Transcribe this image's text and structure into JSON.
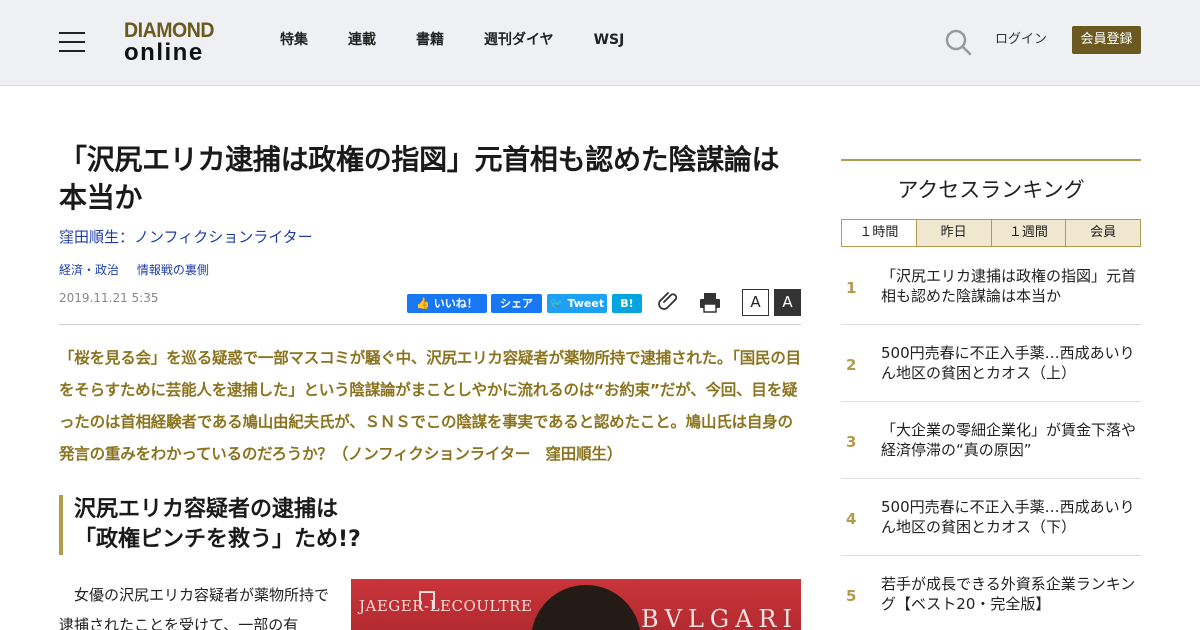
{
  "header": {
    "logo_line1": "DIAMOND",
    "logo_line2": "online",
    "nav": [
      "特集",
      "連載",
      "書籍",
      "週刊ダイヤ",
      "WSJ"
    ],
    "login_label": "ログイン",
    "register_label": "会員登録"
  },
  "article": {
    "title": "「沢尻エリカ逮捕は政権の指図」元首相も認めた陰謀論は本当か",
    "author": "窪田順生：ノンフィクションライター",
    "categories": [
      "経済・政治",
      "情報戦の裏側"
    ],
    "date": "2019.11.21 5:35",
    "share": {
      "like_label": "いいね！",
      "share_label": "シェア",
      "tweet_label": "Tweet",
      "hatena_label": "B!"
    },
    "font_small": "A",
    "font_large": "A",
    "lead": "「桜を見る会」を巡る疑惑で一部マスコミが騒ぐ中、沢尻エリカ容疑者が薬物所持で逮捕された。「国民の目をそらすために芸能人を逮捕した」という陰謀論がまことしやかに流れるのは“お約束”だが、今回、目を疑ったのは首相経験者である鳩山由紀夫氏が、ＳＮＳでこの陰謀を事実であると認めたこと。鳩山氏は自身の発言の重みをわかっているのだろうか？（ノンフィクションライター　窪田順生）",
    "subhead_line1": "沢尻エリカ容疑者の逮捕は",
    "subhead_line2": "「政権ピンチを救う」ため!?",
    "body": "　女優の沢尻エリカ容疑者が薬物所持で逮捕されたことを受けて、一部の有",
    "photo": {
      "brand_left": "JAEGER-LECOULTRE",
      "brand_right": "BVLGARI"
    }
  },
  "sidebar": {
    "ranking_title": "アクセスランキング",
    "tabs": [
      "１時間",
      "昨日",
      "１週間",
      "会員"
    ],
    "items": [
      {
        "rank": "1",
        "title": "「沢尻エリカ逮捕は政権の指図」元首相も認めた陰謀論は本当か"
      },
      {
        "rank": "2",
        "title": "500円売春に不正入手薬…西成あいりん地区の貧困とカオス（上）"
      },
      {
        "rank": "3",
        "title": "「大企業の零細企業化」が賃金下落や経済停滞の“真の原因”"
      },
      {
        "rank": "4",
        "title": "500円売春に不正入手薬…西成あいりん地区の貧困とカオス（下）"
      },
      {
        "rank": "5",
        "title": "若手が成長できる外資系企業ランキング【ベスト20・完全版】"
      }
    ]
  },
  "colors": {
    "brand_gold": "#6b5a1f",
    "lead_gold": "#8b7420",
    "accent_line": "#b39b4e",
    "link_blue": "#1f3ea8"
  }
}
